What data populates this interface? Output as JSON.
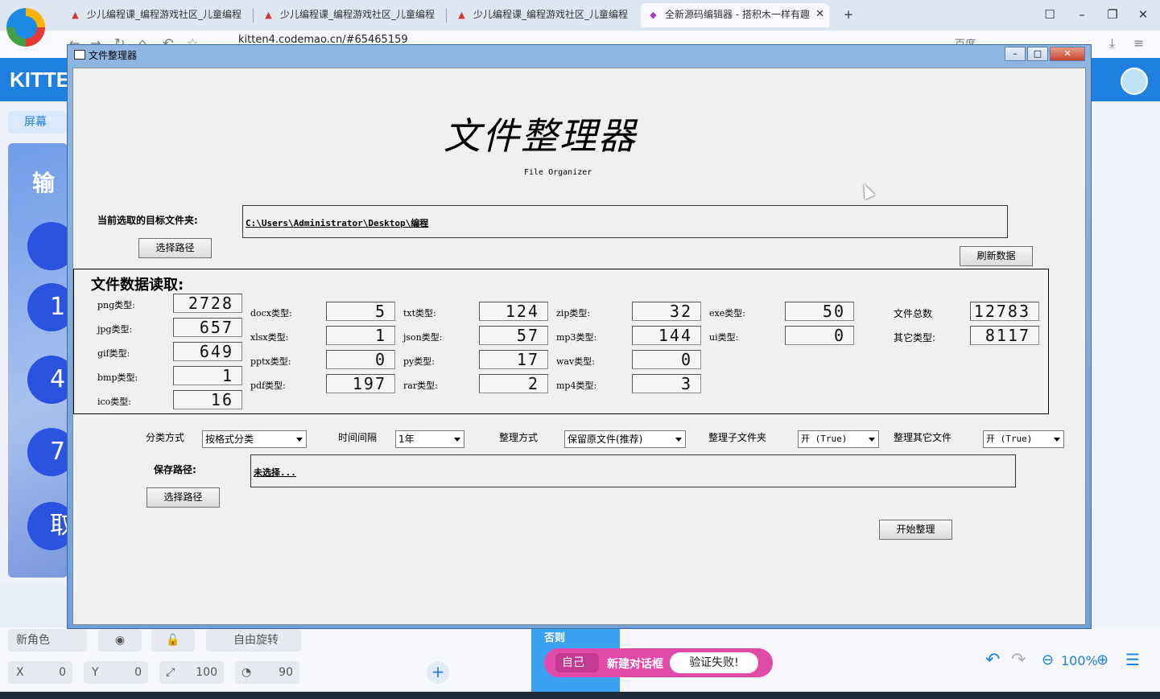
{
  "browser": {
    "tabs": [
      {
        "label": "少儿编程课_编程游戏社区_儿童编程"
      },
      {
        "label": "少儿编程课_编程游戏社区_儿童编程"
      },
      {
        "label": "少儿编程课_编程游戏社区_儿童编程"
      },
      {
        "label": "全新源码编辑器 - 搭积木一样有趣"
      }
    ],
    "url": "kitten4.codemao.cn/#65465159",
    "search_engine": "百度"
  },
  "site": {
    "brand": "KITTE",
    "screen_button": "屏幕",
    "stage_word": "输",
    "stage_buttons": [
      "1",
      "4",
      "7",
      "取"
    ]
  },
  "bottom": {
    "sprite_name": "新角色",
    "rotate_label": "自由旋转",
    "x_label": "X",
    "x_value": "0",
    "y_label": "Y",
    "y_value": "0",
    "size_value": "100",
    "angle_value": "90",
    "else_label": "否则",
    "block_self": "自己",
    "block_name": "新建对话框",
    "block_message": "验证失败!",
    "zoom": "100%"
  },
  "window": {
    "title": "文件整理器",
    "heading": "文件整理器",
    "subheading": "File Organizer",
    "target_label": "当前选取的目标文件夹:",
    "target_path": "C:\\Users\\Administrator\\Desktop\\编程",
    "choose_path_button": "选择路径",
    "refresh_button": "刷新数据",
    "stats_heading": "文件数据读取:",
    "stats": [
      {
        "label": "png类型:",
        "value": "2728"
      },
      {
        "label": "jpg类型:",
        "value": "657"
      },
      {
        "label": "gif类型:",
        "value": "649"
      },
      {
        "label": "bmp类型:",
        "value": "1"
      },
      {
        "label": "ico类型:",
        "value": "16"
      },
      {
        "label": "docx类型:",
        "value": "5"
      },
      {
        "label": "xlsx类型:",
        "value": "1"
      },
      {
        "label": "pptx类型:",
        "value": "0"
      },
      {
        "label": "pdf类型:",
        "value": "197"
      },
      {
        "label": "txt类型:",
        "value": "124"
      },
      {
        "label": "json类型:",
        "value": "57"
      },
      {
        "label": "py类型:",
        "value": "17"
      },
      {
        "label": "rar类型:",
        "value": "2"
      },
      {
        "label": "zip类型:",
        "value": "32"
      },
      {
        "label": "mp3类型:",
        "value": "144"
      },
      {
        "label": "wav类型:",
        "value": "0"
      },
      {
        "label": "mp4类型:",
        "value": "3"
      },
      {
        "label": "exe类型:",
        "value": "50"
      },
      {
        "label": "ui类型:",
        "value": "0"
      },
      {
        "label": "文件总数",
        "value": "12783"
      },
      {
        "label": "其它类型:",
        "value": "8117"
      }
    ],
    "options": {
      "classify_label": "分类方式",
      "classify_value": "按格式分类",
      "interval_label": "时间间隔",
      "interval_value": "1年",
      "mode_label": "整理方式",
      "mode_value": "保留原文件(推荐)",
      "subfolder_label": "整理子文件夹",
      "subfolder_value": "开 (True)",
      "others_label": "整理其它文件",
      "others_value": "开 (True)"
    },
    "save_label": "保存路径:",
    "save_path": "未选择...",
    "save_choose_button": "选择路径",
    "start_button": "开始整理"
  }
}
